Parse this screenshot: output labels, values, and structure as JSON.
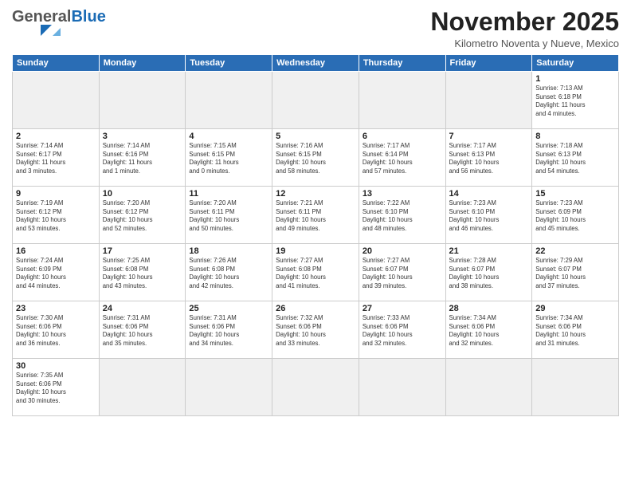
{
  "header": {
    "logo_general": "General",
    "logo_blue": "Blue",
    "month_title": "November 2025",
    "location": "Kilometro Noventa y Nueve, Mexico"
  },
  "weekdays": [
    "Sunday",
    "Monday",
    "Tuesday",
    "Wednesday",
    "Thursday",
    "Friday",
    "Saturday"
  ],
  "weeks": [
    [
      {
        "day": "",
        "info": ""
      },
      {
        "day": "",
        "info": ""
      },
      {
        "day": "",
        "info": ""
      },
      {
        "day": "",
        "info": ""
      },
      {
        "day": "",
        "info": ""
      },
      {
        "day": "",
        "info": ""
      },
      {
        "day": "1",
        "info": "Sunrise: 7:13 AM\nSunset: 6:18 PM\nDaylight: 11 hours\nand 4 minutes."
      }
    ],
    [
      {
        "day": "2",
        "info": "Sunrise: 7:14 AM\nSunset: 6:17 PM\nDaylight: 11 hours\nand 3 minutes."
      },
      {
        "day": "3",
        "info": "Sunrise: 7:14 AM\nSunset: 6:16 PM\nDaylight: 11 hours\nand 1 minute."
      },
      {
        "day": "4",
        "info": "Sunrise: 7:15 AM\nSunset: 6:15 PM\nDaylight: 11 hours\nand 0 minutes."
      },
      {
        "day": "5",
        "info": "Sunrise: 7:16 AM\nSunset: 6:15 PM\nDaylight: 10 hours\nand 58 minutes."
      },
      {
        "day": "6",
        "info": "Sunrise: 7:17 AM\nSunset: 6:14 PM\nDaylight: 10 hours\nand 57 minutes."
      },
      {
        "day": "7",
        "info": "Sunrise: 7:17 AM\nSunset: 6:13 PM\nDaylight: 10 hours\nand 56 minutes."
      },
      {
        "day": "8",
        "info": "Sunrise: 7:18 AM\nSunset: 6:13 PM\nDaylight: 10 hours\nand 54 minutes."
      }
    ],
    [
      {
        "day": "9",
        "info": "Sunrise: 7:19 AM\nSunset: 6:12 PM\nDaylight: 10 hours\nand 53 minutes."
      },
      {
        "day": "10",
        "info": "Sunrise: 7:20 AM\nSunset: 6:12 PM\nDaylight: 10 hours\nand 52 minutes."
      },
      {
        "day": "11",
        "info": "Sunrise: 7:20 AM\nSunset: 6:11 PM\nDaylight: 10 hours\nand 50 minutes."
      },
      {
        "day": "12",
        "info": "Sunrise: 7:21 AM\nSunset: 6:11 PM\nDaylight: 10 hours\nand 49 minutes."
      },
      {
        "day": "13",
        "info": "Sunrise: 7:22 AM\nSunset: 6:10 PM\nDaylight: 10 hours\nand 48 minutes."
      },
      {
        "day": "14",
        "info": "Sunrise: 7:23 AM\nSunset: 6:10 PM\nDaylight: 10 hours\nand 46 minutes."
      },
      {
        "day": "15",
        "info": "Sunrise: 7:23 AM\nSunset: 6:09 PM\nDaylight: 10 hours\nand 45 minutes."
      }
    ],
    [
      {
        "day": "16",
        "info": "Sunrise: 7:24 AM\nSunset: 6:09 PM\nDaylight: 10 hours\nand 44 minutes."
      },
      {
        "day": "17",
        "info": "Sunrise: 7:25 AM\nSunset: 6:08 PM\nDaylight: 10 hours\nand 43 minutes."
      },
      {
        "day": "18",
        "info": "Sunrise: 7:26 AM\nSunset: 6:08 PM\nDaylight: 10 hours\nand 42 minutes."
      },
      {
        "day": "19",
        "info": "Sunrise: 7:27 AM\nSunset: 6:08 PM\nDaylight: 10 hours\nand 41 minutes."
      },
      {
        "day": "20",
        "info": "Sunrise: 7:27 AM\nSunset: 6:07 PM\nDaylight: 10 hours\nand 39 minutes."
      },
      {
        "day": "21",
        "info": "Sunrise: 7:28 AM\nSunset: 6:07 PM\nDaylight: 10 hours\nand 38 minutes."
      },
      {
        "day": "22",
        "info": "Sunrise: 7:29 AM\nSunset: 6:07 PM\nDaylight: 10 hours\nand 37 minutes."
      }
    ],
    [
      {
        "day": "23",
        "info": "Sunrise: 7:30 AM\nSunset: 6:06 PM\nDaylight: 10 hours\nand 36 minutes."
      },
      {
        "day": "24",
        "info": "Sunrise: 7:31 AM\nSunset: 6:06 PM\nDaylight: 10 hours\nand 35 minutes."
      },
      {
        "day": "25",
        "info": "Sunrise: 7:31 AM\nSunset: 6:06 PM\nDaylight: 10 hours\nand 34 minutes."
      },
      {
        "day": "26",
        "info": "Sunrise: 7:32 AM\nSunset: 6:06 PM\nDaylight: 10 hours\nand 33 minutes."
      },
      {
        "day": "27",
        "info": "Sunrise: 7:33 AM\nSunset: 6:06 PM\nDaylight: 10 hours\nand 32 minutes."
      },
      {
        "day": "28",
        "info": "Sunrise: 7:34 AM\nSunset: 6:06 PM\nDaylight: 10 hours\nand 32 minutes."
      },
      {
        "day": "29",
        "info": "Sunrise: 7:34 AM\nSunset: 6:06 PM\nDaylight: 10 hours\nand 31 minutes."
      }
    ],
    [
      {
        "day": "30",
        "info": "Sunrise: 7:35 AM\nSunset: 6:06 PM\nDaylight: 10 hours\nand 30 minutes."
      },
      {
        "day": "",
        "info": ""
      },
      {
        "day": "",
        "info": ""
      },
      {
        "day": "",
        "info": ""
      },
      {
        "day": "",
        "info": ""
      },
      {
        "day": "",
        "info": ""
      },
      {
        "day": "",
        "info": ""
      }
    ]
  ]
}
